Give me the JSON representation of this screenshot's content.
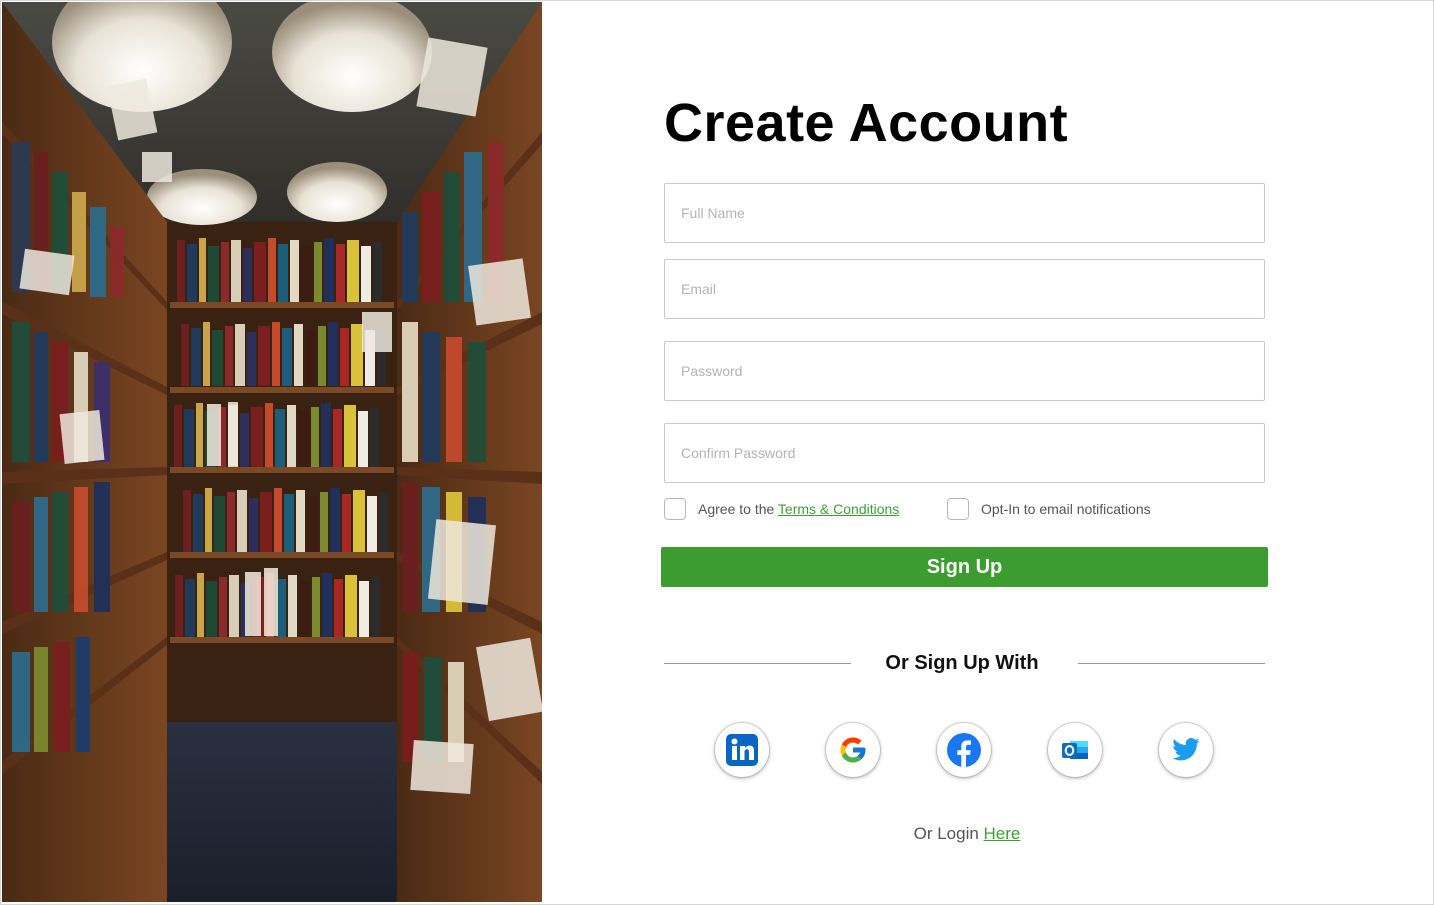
{
  "form": {
    "title": "Create Account",
    "fields": {
      "full_name": {
        "placeholder": "Full Name",
        "value": ""
      },
      "email": {
        "placeholder": "Email",
        "value": ""
      },
      "password": {
        "placeholder": "Password",
        "value": ""
      },
      "confirm_password": {
        "placeholder": "Confirm Password",
        "value": ""
      }
    },
    "agree": {
      "prefix": "Agree to the ",
      "link": "Terms & Conditions",
      "checked": false
    },
    "optin": {
      "label": "Opt-In to email notifications",
      "checked": false
    },
    "signup_label": "Sign Up",
    "divider_text": "Or Sign Up With",
    "social": [
      {
        "icon": "linkedin-icon",
        "color": "#0a66c2"
      },
      {
        "icon": "google-icon",
        "color": "#4285f4"
      },
      {
        "icon": "facebook-icon",
        "color": "#1877f2"
      },
      {
        "icon": "outlook-icon",
        "color": "#0f6cbd"
      },
      {
        "icon": "twitter-icon",
        "color": "#1d9bf0"
      }
    ],
    "login": {
      "prefix": "Or Login ",
      "link": "Here"
    }
  },
  "colors": {
    "accent": "#3c9c30",
    "link": "#3e9f34"
  },
  "image": {
    "subject": "library-bookshelves-photo"
  }
}
